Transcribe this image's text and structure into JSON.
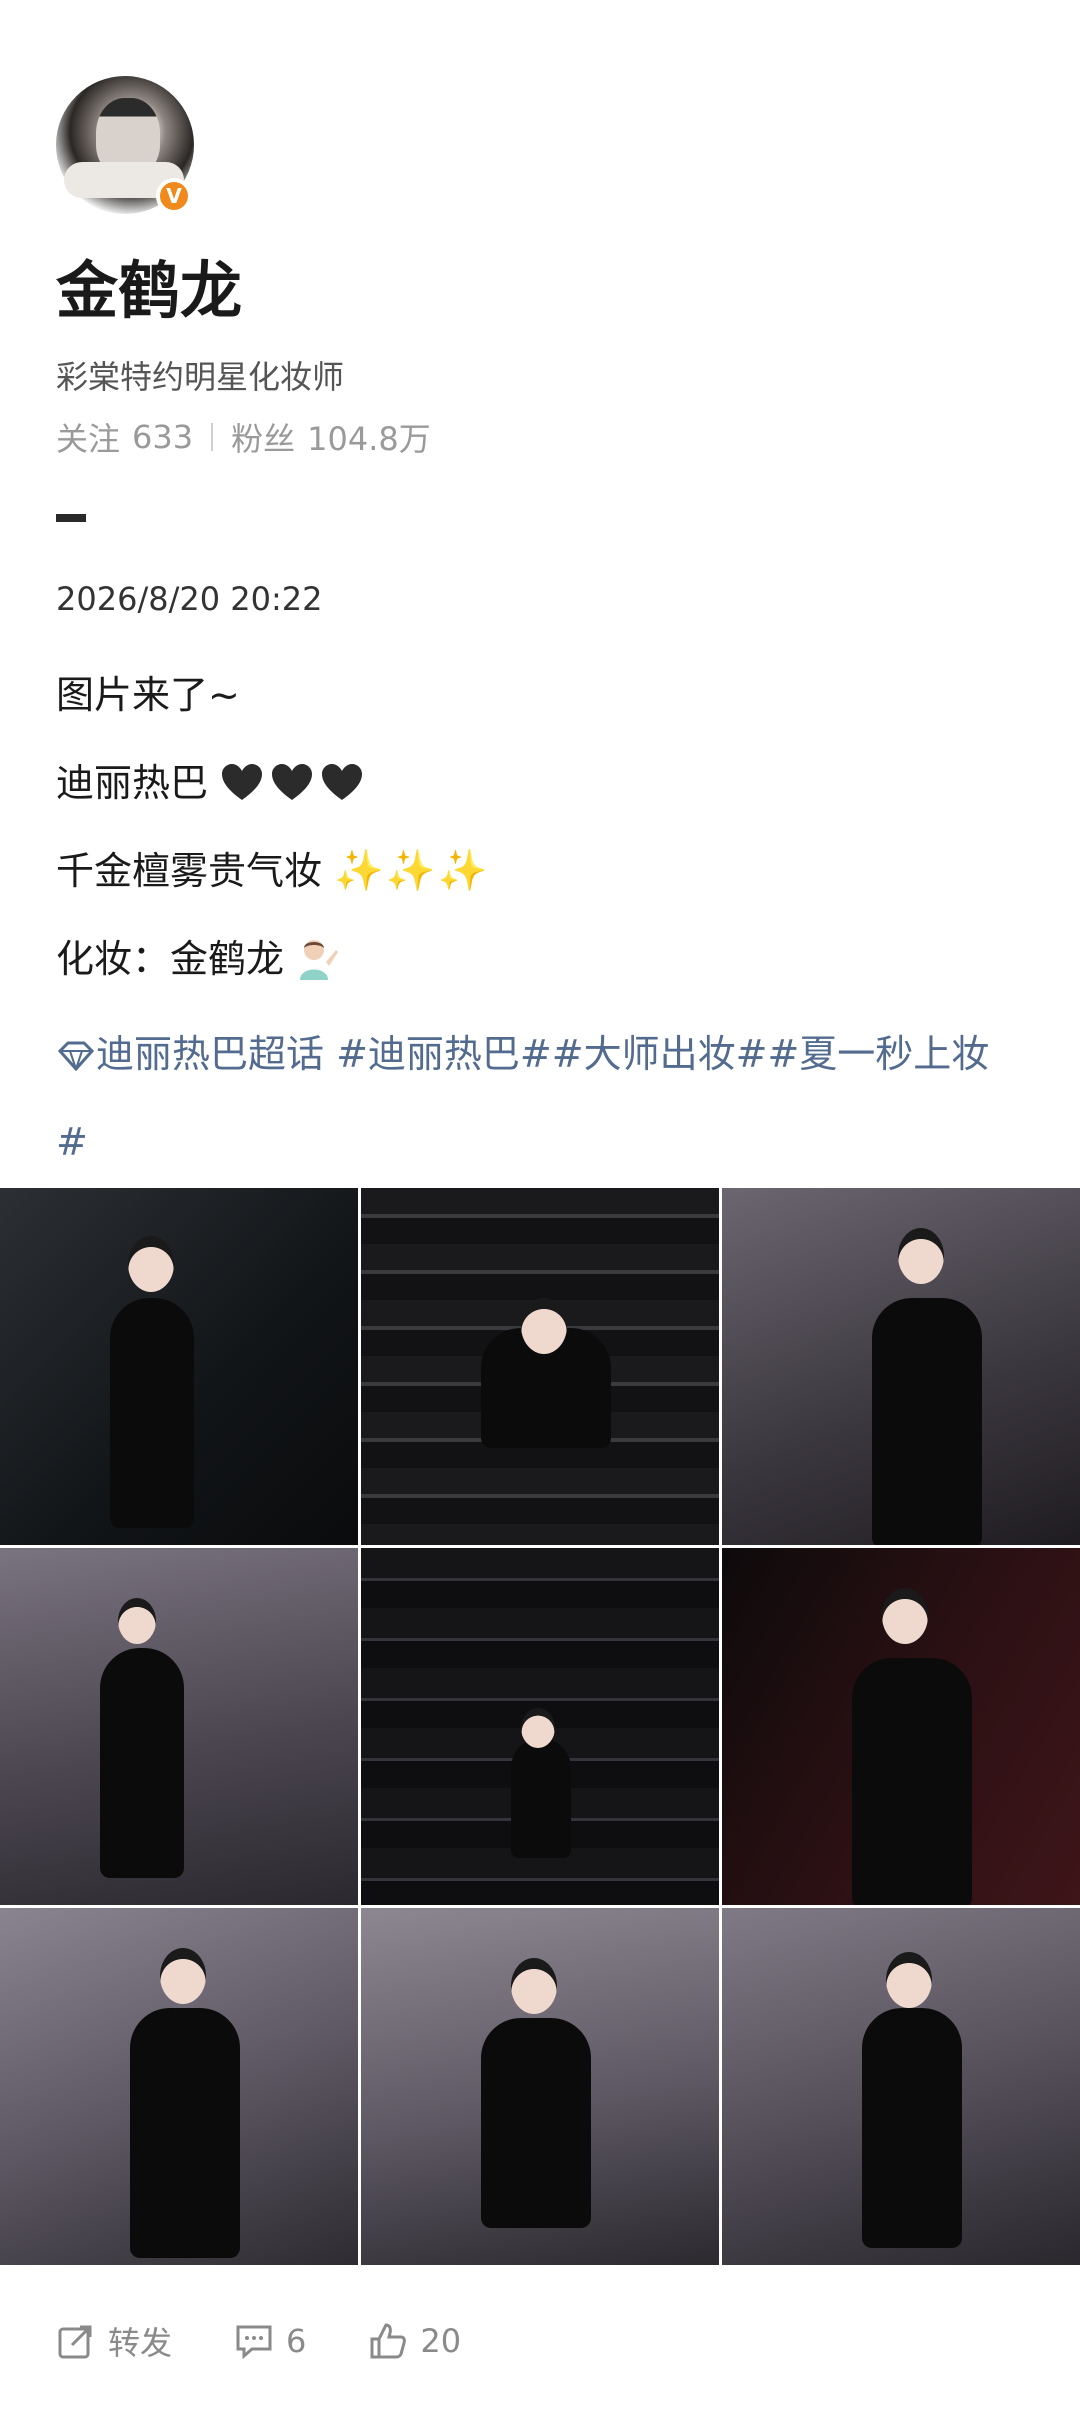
{
  "profile": {
    "name": "金鹤龙",
    "bio": "彩棠特约明星化妆师",
    "following_label": "关注",
    "following_count": "633",
    "followers_label": "粉丝",
    "followers_count": "104.8万",
    "verified_mark": "V"
  },
  "post": {
    "timestamp": "2026/8/20 20:22",
    "line1": "图片来了~",
    "line2": "迪丽热巴",
    "line3": "千金檀雾贵气妆",
    "line4": "化妆：金鹤龙",
    "tags_text": "迪丽热巴超话 #迪丽热巴##大师出妆##夏一秒上妆#",
    "emoji_hearts": [
      "black-heart",
      "black-heart",
      "black-heart"
    ],
    "emoji_sparkles": [
      "sparkles",
      "sparkles",
      "sparkles"
    ],
    "emoji_person": "person-gesture"
  },
  "photos": [
    {
      "name": "photo-1"
    },
    {
      "name": "photo-2"
    },
    {
      "name": "photo-3"
    },
    {
      "name": "photo-4"
    },
    {
      "name": "photo-5"
    },
    {
      "name": "photo-6"
    },
    {
      "name": "photo-7"
    },
    {
      "name": "photo-8"
    },
    {
      "name": "photo-9"
    }
  ],
  "actions": {
    "repost_label": "转发",
    "comments_count": "6",
    "likes_count": "20"
  },
  "colors": {
    "tag_link": "#526b8f",
    "verified_badge": "#f08a1c"
  }
}
